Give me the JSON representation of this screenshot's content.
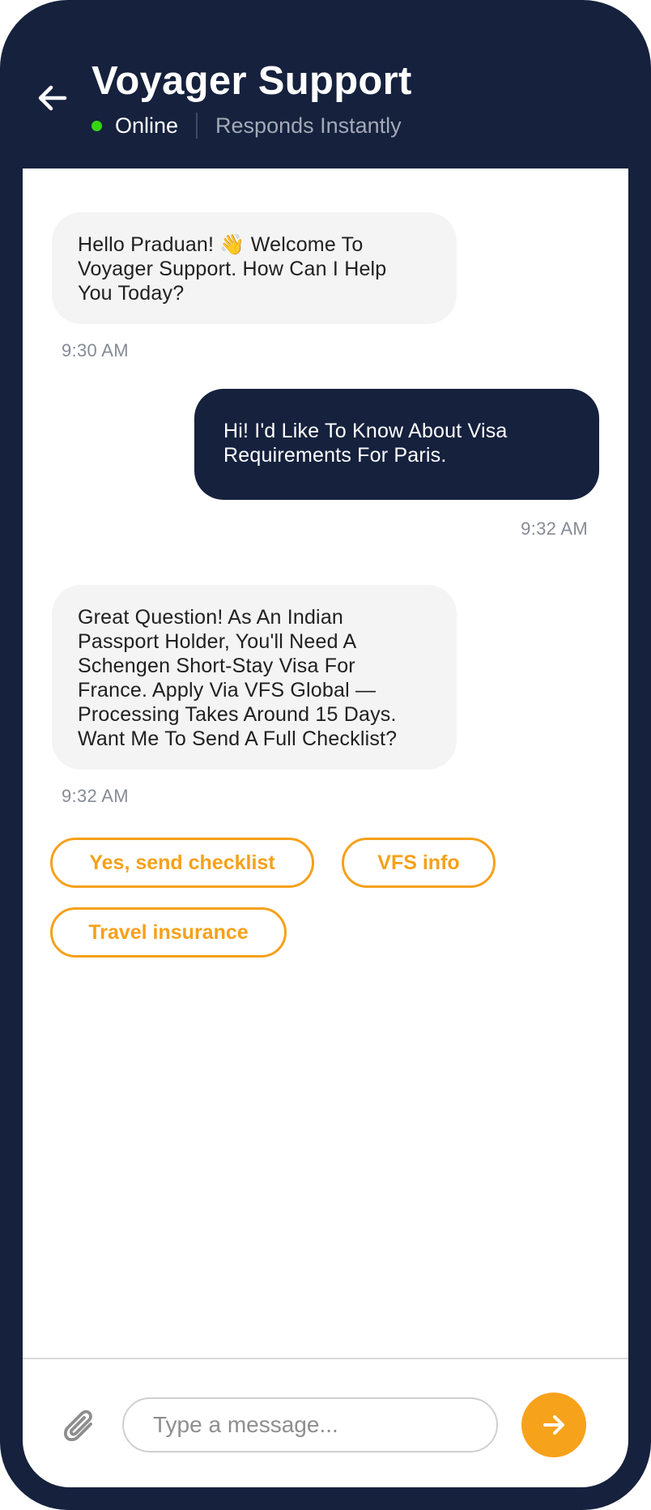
{
  "header": {
    "title": "Voyager Support",
    "status": "Online",
    "status_sub": "Responds Instantly",
    "status_color": "#35d60f"
  },
  "messages": [
    {
      "from": "agent",
      "lines": [
        "Hello Praduan! 👋 Welcome To",
        "Voyager Support. How Can I Help",
        "You Today?"
      ],
      "time": "9:30 AM"
    },
    {
      "from": "user",
      "lines": [
        "Hi! I'd Like To Know About Visa",
        "Requirements For Paris."
      ],
      "time": "9:32 AM"
    },
    {
      "from": "agent",
      "lines": [
        "Great Question! As An Indian",
        "Passport Holder, You'll Need A",
        "Schengen Short-Stay Visa For",
        "France. Apply Via VFS Global —",
        "Processing Takes Around 15 Days.",
        "Want Me To Send A Full Checklist?"
      ],
      "time": "9:32 AM"
    }
  ],
  "quick_replies": [
    "Yes, send checklist",
    "VFS info",
    "Travel insurance"
  ],
  "composer": {
    "placeholder": "Type a message...",
    "value": ""
  },
  "icons": {
    "back": "arrow-left-icon",
    "attach": "paperclip-icon",
    "send": "arrow-right-icon"
  },
  "colors": {
    "brand_navy": "#15213d",
    "accent_orange": "#f5a119",
    "agent_bubble": "#f4f4f4"
  }
}
